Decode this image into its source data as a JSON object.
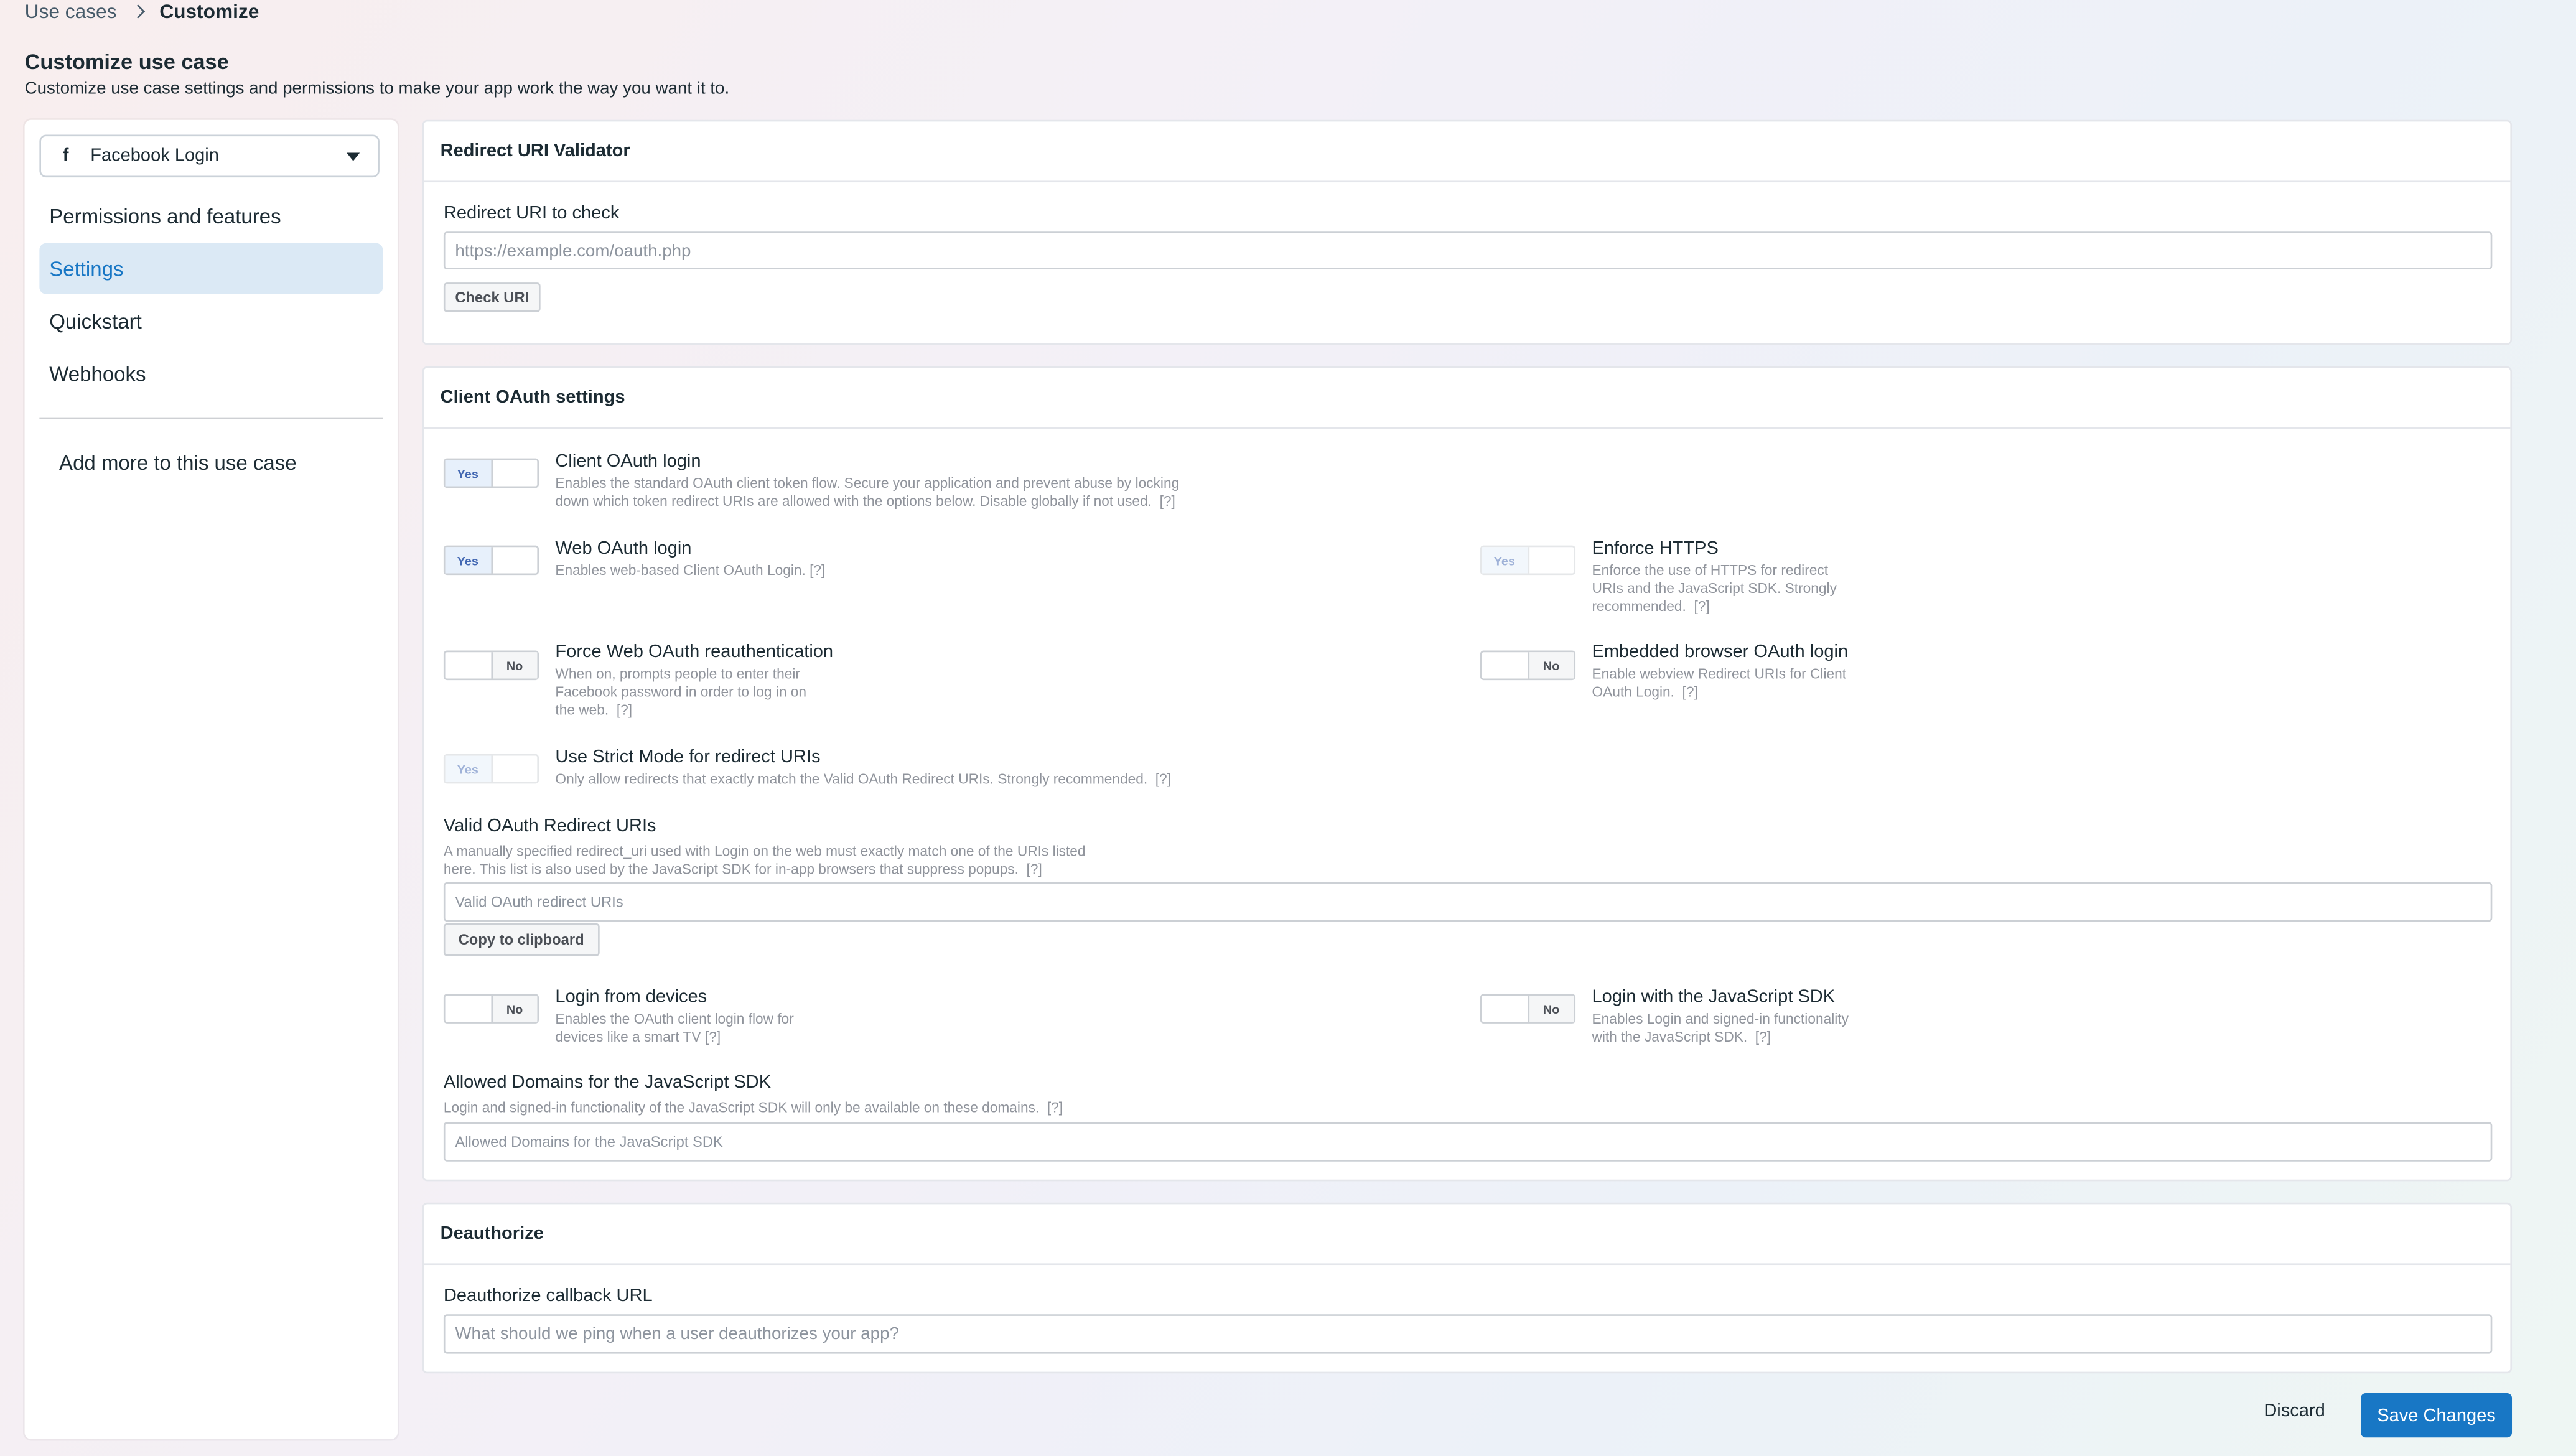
{
  "breadcrumb": {
    "parent": "Use cases",
    "current": "Customize"
  },
  "page": {
    "title": "Customize use case",
    "subtitle": "Customize use case settings and permissions to make your app work the way you want it to."
  },
  "sidebar": {
    "usecase": "Facebook Login",
    "fb_glyph": "f",
    "items": [
      {
        "label": "Permissions and features"
      },
      {
        "label": "Settings"
      },
      {
        "label": "Quickstart"
      },
      {
        "label": "Webhooks"
      }
    ],
    "add_more": "Add more to this use case"
  },
  "redirect_validator": {
    "header": "Redirect URI Validator",
    "field_label": "Redirect URI to check",
    "placeholder": "https://example.com/oauth.php",
    "button": "Check URI"
  },
  "client_oauth": {
    "header": "Client OAuth settings",
    "yes": "Yes",
    "no": "No",
    "help": "[?]",
    "client_oauth_login": {
      "title": "Client OAuth login",
      "desc1": "Enables the standard OAuth client token flow. Secure your application and prevent abuse by locking",
      "desc2": "down which token redirect URIs are allowed with the options below. Disable globally if not used."
    },
    "web_oauth_login": {
      "title": "Web OAuth login",
      "desc": "Enables web-based Client OAuth Login."
    },
    "enforce_https": {
      "title": "Enforce HTTPS",
      "desc1": "Enforce the use of HTTPS for redirect",
      "desc2": "URIs and the JavaScript SDK. Strongly",
      "desc3": "recommended."
    },
    "force_reauth": {
      "title": "Force Web OAuth reauthentication",
      "desc1": "When on, prompts people to enter their",
      "desc2": "Facebook password in order to log in on",
      "desc3": "the web."
    },
    "embedded_browser": {
      "title": "Embedded browser OAuth login",
      "desc1": "Enable webview Redirect URIs for Client",
      "desc2": "OAuth Login."
    },
    "strict_mode": {
      "title": "Use Strict Mode for redirect URIs",
      "desc": "Only allow redirects that exactly match the Valid OAuth Redirect URIs. Strongly recommended."
    },
    "valid_uris": {
      "label": "Valid OAuth Redirect URIs",
      "desc1": "A manually specified redirect_uri used with Login on the web must exactly match one of the URIs listed",
      "desc2": "here. This list is also used by the JavaScript SDK for in-app browsers that suppress popups.",
      "placeholder": "Valid OAuth redirect URIs",
      "button": "Copy to clipboard"
    },
    "login_devices": {
      "title": "Login from devices",
      "desc1": "Enables the OAuth client login flow for",
      "desc2": "devices like a smart TV"
    },
    "login_js_sdk": {
      "title": "Login with the JavaScript SDK",
      "desc1": "Enables Login and signed-in functionality",
      "desc2": "with the JavaScript SDK."
    },
    "allowed_domains": {
      "label": "Allowed Domains for the JavaScript SDK",
      "desc": "Login and signed-in functionality of the JavaScript SDK will only be available on these domains.",
      "placeholder": "Allowed Domains for the JavaScript SDK"
    }
  },
  "deauthorize": {
    "header": "Deauthorize",
    "field_label": "Deauthorize callback URL",
    "placeholder": "What should we ping when a user deauthorizes your app?"
  },
  "footer": {
    "discard": "Discard",
    "save": "Save Changes"
  },
  "colors": {
    "accent": "#1877c5",
    "active_bg": "#dbe9f5"
  }
}
